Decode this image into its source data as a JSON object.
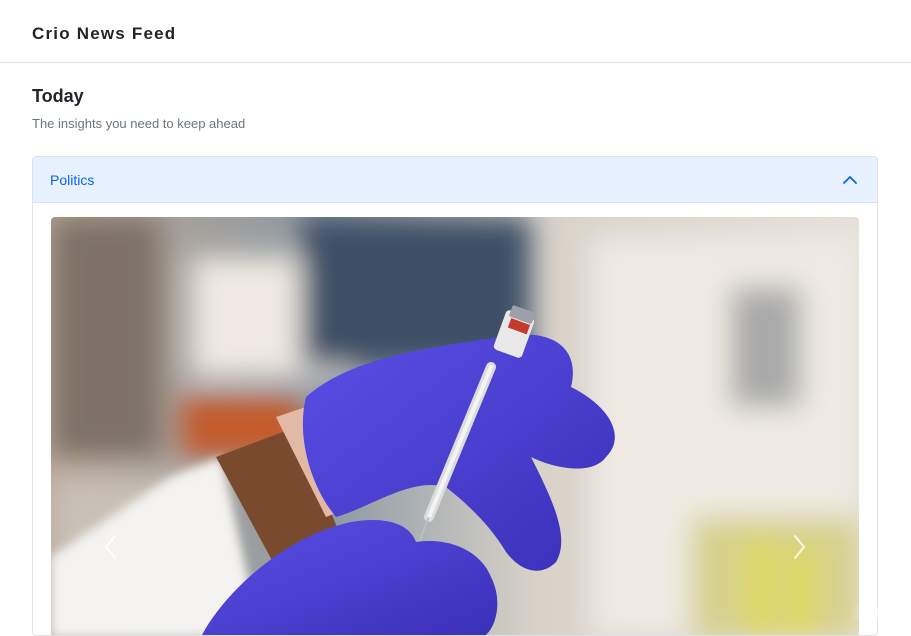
{
  "header": {
    "brand": "Crio News Feed"
  },
  "page": {
    "title": "Today",
    "subtitle": "The insights you need to keep ahead"
  },
  "accordion": {
    "section_title": "Politics",
    "expanded": true
  },
  "carousel": {
    "image_alt": "vaccine-injection-photo",
    "prev_icon": "chevron-left-icon",
    "next_icon": "chevron-right-icon"
  },
  "colors": {
    "accent": "#0c63e4",
    "accordion_header_bg": "#e7f1ff",
    "glove": "#4a3fd8"
  }
}
